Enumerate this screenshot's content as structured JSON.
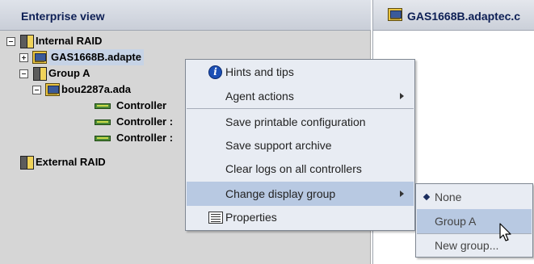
{
  "left_panel": {
    "header": "Enterprise view"
  },
  "tree": {
    "nodes": [
      {
        "label": "Internal RAID",
        "icon": "raid-icon",
        "expander": "minus"
      },
      {
        "label": "GAS1668B.adapte",
        "icon": "server-icon",
        "expander": "plus",
        "selected": true
      },
      {
        "label": "Group A",
        "icon": "raid-icon",
        "expander": "minus"
      },
      {
        "label": "bou2287a.ada",
        "icon": "server-icon",
        "expander": "minus"
      },
      {
        "label": "Controller",
        "icon": "controller-icon"
      },
      {
        "label": "Controller :",
        "icon": "controller-icon"
      },
      {
        "label": "Controller :",
        "icon": "controller-icon"
      },
      {
        "label": "External RAID",
        "icon": "raid-icon"
      }
    ]
  },
  "right_panel": {
    "header": "GAS1668B.adaptec.c"
  },
  "context_menu": {
    "items": [
      {
        "label": "Hints and tips",
        "icon": "info-icon"
      },
      {
        "label": "Agent actions",
        "submenu": true
      },
      {
        "label": "Save printable configuration"
      },
      {
        "label": "Save support archive"
      },
      {
        "label": "Clear logs on all controllers"
      },
      {
        "label": "Change display group",
        "submenu": true,
        "highlighted": true
      },
      {
        "label": "Properties",
        "icon": "properties-icon"
      }
    ]
  },
  "submenu": {
    "items": [
      {
        "label": "None",
        "selected": true
      },
      {
        "label": "Group A",
        "highlighted": true
      },
      {
        "label": "New group..."
      }
    ]
  },
  "colors": {
    "panel_bg": "#d6d6d6",
    "menu_bg": "#e8ecf3",
    "menu_highlight": "#b8c9e2",
    "header_text": "#0d1f55"
  }
}
